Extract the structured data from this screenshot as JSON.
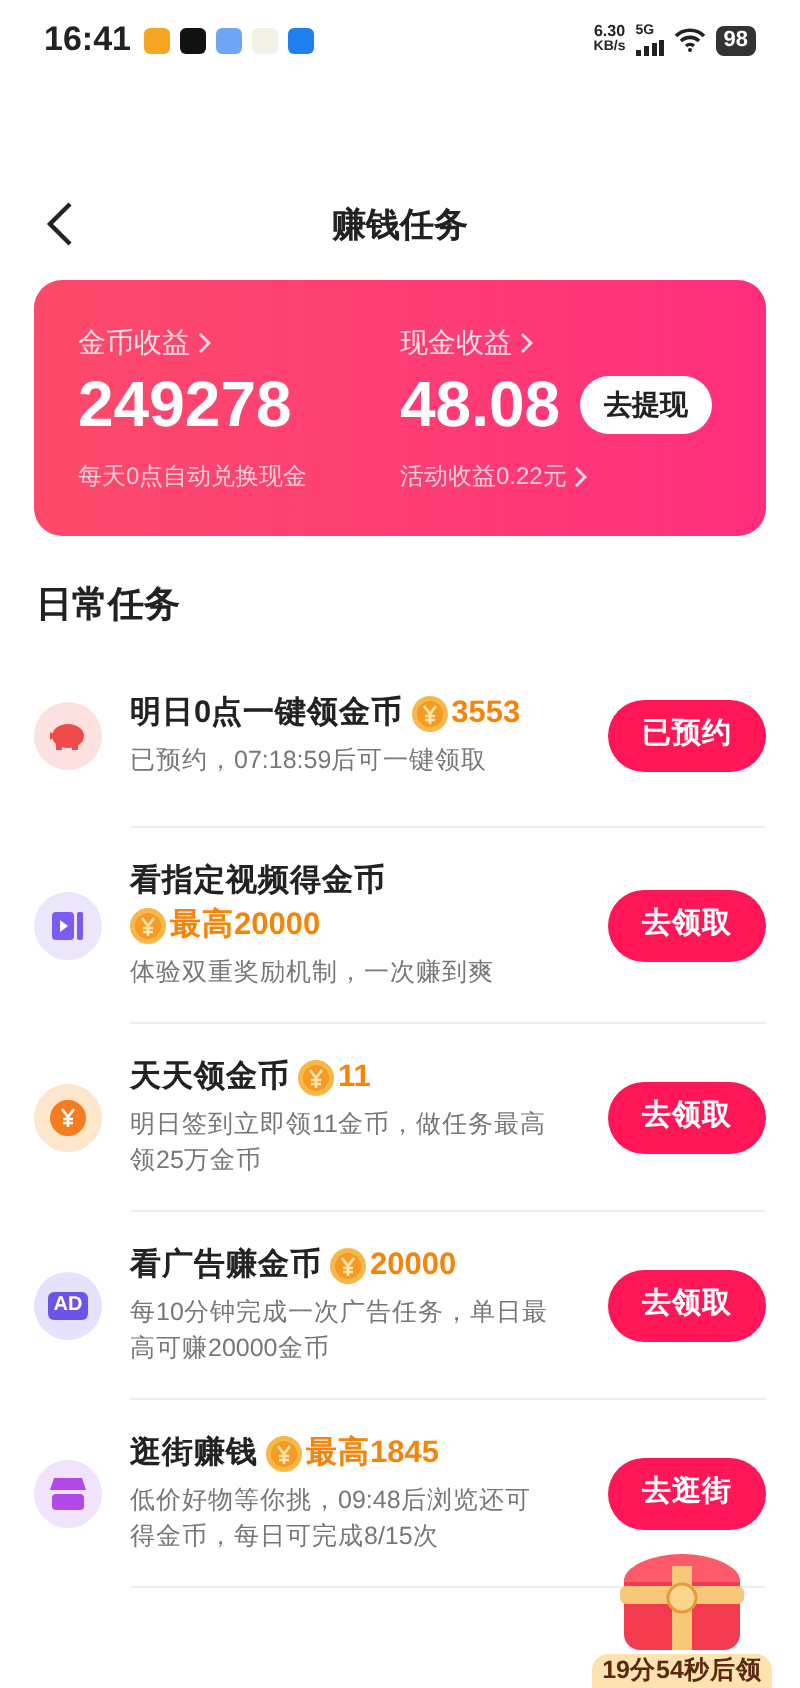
{
  "status_bar": {
    "time": "16:41",
    "net_speed_value": "6.30",
    "net_speed_unit": "KB/s",
    "network": "5G",
    "battery": "98"
  },
  "header": {
    "title": "赚钱任务"
  },
  "earnings": {
    "coins_label": "金币收益",
    "coins_value": "249278",
    "coins_note": "每天0点自动兑换现金",
    "cash_label": "现金收益",
    "cash_value": "48.08",
    "withdraw_button": "去提现",
    "cash_note": "活动收益0.22元"
  },
  "section_title": "日常任务",
  "tasks": [
    {
      "kind": "piggy",
      "title": "明日0点一键领金币",
      "reward": "3553",
      "description": "已预约，07:18:59后可一键领取",
      "button": "已预约"
    },
    {
      "kind": "video",
      "title": "看指定视频得金币",
      "reward": "最高20000",
      "description": "体验双重奖励机制，一次赚到爽",
      "button": "去领取"
    },
    {
      "kind": "yen",
      "title": "天天领金币",
      "reward": "11",
      "description": "明日签到立即领11金币，做任务最高领25万金币",
      "button": "去领取"
    },
    {
      "kind": "ad",
      "icon_text": "AD",
      "title": "看广告赚金币",
      "reward": "20000",
      "description": "每10分钟完成一次广告任务，单日最高可赚20000金币",
      "button": "去领取"
    },
    {
      "kind": "shop",
      "title": "逛街赚钱",
      "reward": "最高1845",
      "description": "低价好物等你挑，09:48后浏览还可得金币，每日可完成8/15次",
      "button": "去逛街"
    }
  ],
  "floating_reward": {
    "countdown": "19分54秒后领"
  }
}
